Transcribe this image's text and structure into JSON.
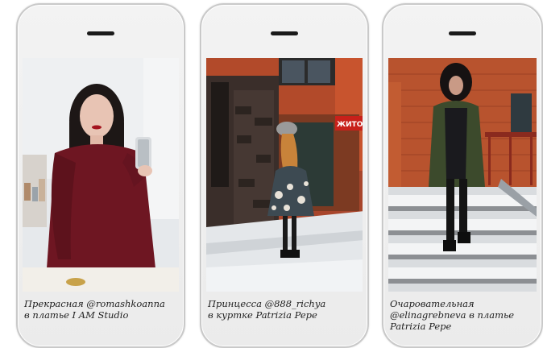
{
  "cards": [
    {
      "caption_line1": "Прекрасная @romashkoanna",
      "caption_line2": "в платье I AM Studio",
      "caption_line3": "",
      "photo": "woman-in-burgundy-dress-taking-mirror-selfie"
    },
    {
      "caption_line1": "Принцесса @888_richya",
      "caption_line2": "в куртке Patrizia Pepe",
      "caption_line3": "",
      "photo": "girl-in-floral-dress-on-snowy-street"
    },
    {
      "caption_line1": "Очаровательная",
      "caption_line2": "@elinagrebneva в платье",
      "caption_line3": "Patrizia Pepe",
      "photo": "woman-in-parka-on-snowy-steps"
    }
  ],
  "storefront_sign": "ЖИТОМ"
}
